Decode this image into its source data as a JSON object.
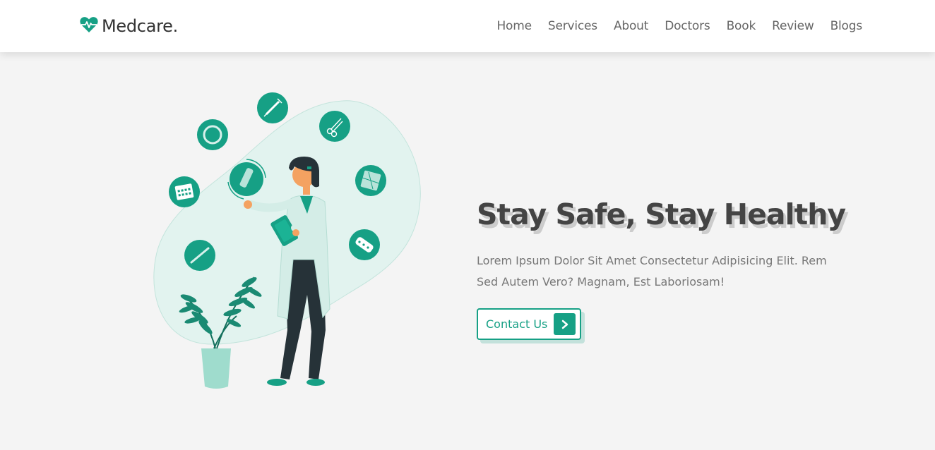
{
  "brand": {
    "name": "Medcare.",
    "icon": "heart-pulse-icon",
    "color": "#16a085"
  },
  "nav": {
    "items": [
      {
        "label": "Home"
      },
      {
        "label": "Services"
      },
      {
        "label": "About"
      },
      {
        "label": "Doctors"
      },
      {
        "label": "Book"
      },
      {
        "label": "Review"
      },
      {
        "label": "Blogs"
      }
    ]
  },
  "hero": {
    "title": "Stay Safe, Stay Healthy",
    "text": "Lorem Ipsum Dolor Sit Amet Consectetur Adipisicing Elit. Rem Sed Autem Vero? Magnam, Est Laboriosam!",
    "button": {
      "label": "Contact Us",
      "icon": "chevron-right-icon"
    },
    "illustration": "doctor-with-medical-icons"
  },
  "colors": {
    "accent": "#16a085",
    "heading": "#444444",
    "body_text": "#777777",
    "background": "#f4f4f4"
  }
}
